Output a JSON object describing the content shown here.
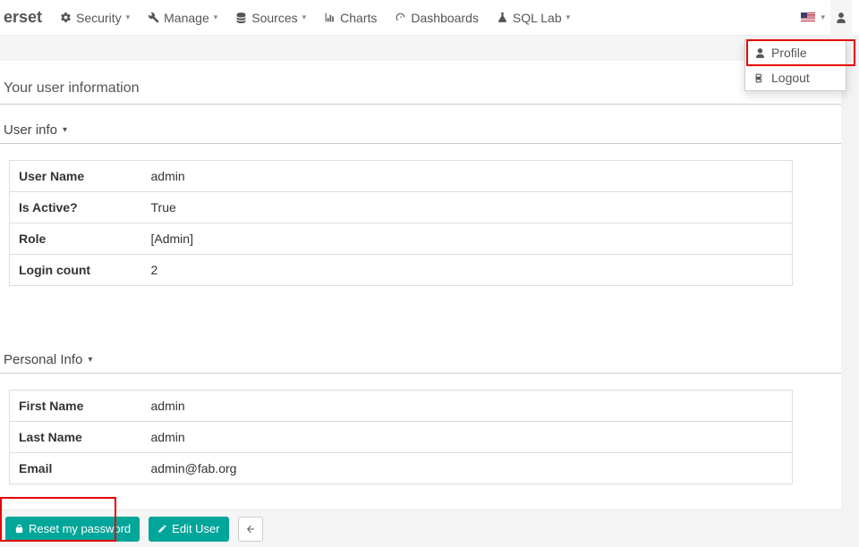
{
  "brand": "erset",
  "nav": {
    "security": "Security",
    "manage": "Manage",
    "sources": "Sources",
    "charts": "Charts",
    "dashboards": "Dashboards",
    "sqllab": "SQL Lab"
  },
  "user_menu": {
    "profile": "Profile",
    "logout": "Logout"
  },
  "page_title": "Your user information",
  "sections": {
    "user_info_title": "User info",
    "personal_info_title": "Personal Info"
  },
  "user_info": {
    "rows": [
      {
        "label": "User Name",
        "value": "admin"
      },
      {
        "label": "Is Active?",
        "value": "True"
      },
      {
        "label": "Role",
        "value": "[Admin]"
      },
      {
        "label": "Login count",
        "value": "2"
      }
    ]
  },
  "personal_info": {
    "rows": [
      {
        "label": "First Name",
        "value": "admin"
      },
      {
        "label": "Last Name",
        "value": "admin"
      },
      {
        "label": "Email",
        "value": "admin@fab.org"
      }
    ]
  },
  "buttons": {
    "reset_password": "Reset my password",
    "edit_user": "Edit User"
  }
}
